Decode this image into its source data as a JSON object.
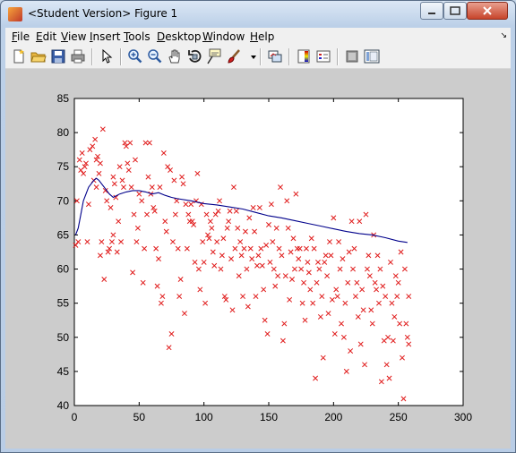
{
  "window": {
    "title": "<Student Version> Figure 1"
  },
  "menu": [
    "File",
    "Edit",
    "View",
    "Insert",
    "Tools",
    "Desktop",
    "Window",
    "Help"
  ],
  "toolbar_icons": [
    "new-figure-icon",
    "open-file-icon",
    "save-icon",
    "print-icon",
    "pointer-icon",
    "zoom-in-icon",
    "zoom-out-icon",
    "pan-hand-icon",
    "rotate-3d-icon",
    "data-cursor-icon",
    "brush-icon",
    "brush-dropdown-icon",
    "link-plot-icon",
    "colorbar-icon",
    "legend-icon",
    "hide-plot-tools-icon",
    "show-plot-tools-icon"
  ],
  "chart_data": {
    "type": "scatter",
    "title": "",
    "xlabel": "",
    "ylabel": "",
    "xlim": [
      0,
      300
    ],
    "ylim": [
      40,
      85
    ],
    "xticks": [
      0,
      50,
      100,
      150,
      200,
      250,
      300
    ],
    "yticks": [
      40,
      45,
      50,
      55,
      60,
      65,
      70,
      75,
      80,
      85
    ],
    "grid": false,
    "colors": {
      "scatter": "#e01a1a",
      "line": "#00008b"
    },
    "series": [
      {
        "kind": "scatter",
        "marker": "x",
        "points": [
          [
            1,
            63.5
          ],
          [
            2,
            70
          ],
          [
            3,
            64
          ],
          [
            4,
            76
          ],
          [
            5,
            74.5
          ],
          [
            6,
            77
          ],
          [
            7,
            74
          ],
          [
            8,
            75
          ],
          [
            9,
            75.5
          ],
          [
            10,
            64
          ],
          [
            11,
            69.5
          ],
          [
            12,
            77.5
          ],
          [
            14,
            78
          ],
          [
            15,
            73
          ],
          [
            16,
            79
          ],
          [
            17,
            72
          ],
          [
            17,
            76
          ],
          [
            18,
            76.5
          ],
          [
            19,
            74
          ],
          [
            20,
            62
          ],
          [
            20,
            75.5
          ],
          [
            21,
            64
          ],
          [
            22,
            80.5
          ],
          [
            23,
            58.5
          ],
          [
            24,
            71.5
          ],
          [
            25,
            70
          ],
          [
            26,
            62.5
          ],
          [
            27,
            63
          ],
          [
            28,
            69
          ],
          [
            29,
            64
          ],
          [
            30,
            73.5
          ],
          [
            30,
            65
          ],
          [
            31,
            72.5
          ],
          [
            32,
            70.5
          ],
          [
            33,
            62.5
          ],
          [
            34,
            67
          ],
          [
            35,
            75
          ],
          [
            36,
            64
          ],
          [
            37,
            73
          ],
          [
            38,
            72
          ],
          [
            39,
            78.5
          ],
          [
            40,
            78
          ],
          [
            41,
            75.5
          ],
          [
            42,
            74.5
          ],
          [
            43,
            78.5
          ],
          [
            44,
            72
          ],
          [
            45,
            59.5
          ],
          [
            46,
            68
          ],
          [
            47,
            76
          ],
          [
            48,
            64
          ],
          [
            49,
            66
          ],
          [
            50,
            71
          ],
          [
            52,
            70
          ],
          [
            53,
            58
          ],
          [
            54,
            63
          ],
          [
            55,
            78.5
          ],
          [
            56,
            68
          ],
          [
            57,
            73.5
          ],
          [
            58,
            78.5
          ],
          [
            59,
            71
          ],
          [
            60,
            72
          ],
          [
            61,
            69
          ],
          [
            62,
            68.5
          ],
          [
            63,
            63
          ],
          [
            64,
            57.5
          ],
          [
            65,
            61.5
          ],
          [
            66,
            72
          ],
          [
            67,
            55
          ],
          [
            68,
            56
          ],
          [
            69,
            77
          ],
          [
            70,
            67
          ],
          [
            71,
            65.5
          ],
          [
            72,
            75
          ],
          [
            73,
            48.5
          ],
          [
            74,
            74.5
          ],
          [
            75,
            50.5
          ],
          [
            76,
            64
          ],
          [
            77,
            73
          ],
          [
            78,
            68
          ],
          [
            79,
            70
          ],
          [
            80,
            63
          ],
          [
            81,
            56
          ],
          [
            82,
            58.5
          ],
          [
            83,
            73.5
          ],
          [
            84,
            72.5
          ],
          [
            85,
            53.5
          ],
          [
            86,
            69.5
          ],
          [
            87,
            63
          ],
          [
            88,
            68
          ],
          [
            89,
            67
          ],
          [
            90,
            69.5
          ],
          [
            91,
            67
          ],
          [
            92,
            66.5
          ],
          [
            93,
            61
          ],
          [
            94,
            70
          ],
          [
            95,
            74
          ],
          [
            96,
            60
          ],
          [
            97,
            57
          ],
          [
            98,
            69.5
          ],
          [
            99,
            64
          ],
          [
            100,
            61
          ],
          [
            101,
            55
          ],
          [
            102,
            68
          ],
          [
            103,
            65
          ],
          [
            104,
            64.5
          ],
          [
            105,
            67
          ],
          [
            106,
            66
          ],
          [
            107,
            62.5
          ],
          [
            108,
            60.5
          ],
          [
            109,
            68
          ],
          [
            110,
            64
          ],
          [
            111,
            68.5
          ],
          [
            112,
            70
          ],
          [
            113,
            60
          ],
          [
            114,
            62
          ],
          [
            115,
            64.5
          ],
          [
            116,
            56
          ],
          [
            117,
            55.5
          ],
          [
            118,
            66
          ],
          [
            119,
            67
          ],
          [
            120,
            68.5
          ],
          [
            121,
            61.5
          ],
          [
            122,
            54
          ],
          [
            123,
            72
          ],
          [
            124,
            63
          ],
          [
            125,
            68.5
          ],
          [
            126,
            66
          ],
          [
            127,
            59
          ],
          [
            128,
            64
          ],
          [
            129,
            62
          ],
          [
            130,
            56
          ],
          [
            131,
            63
          ],
          [
            132,
            65.5
          ],
          [
            133,
            60
          ],
          [
            134,
            54.5
          ],
          [
            135,
            67.5
          ],
          [
            136,
            63
          ],
          [
            137,
            61.5
          ],
          [
            138,
            69
          ],
          [
            139,
            65.5
          ],
          [
            140,
            56
          ],
          [
            141,
            60.5
          ],
          [
            142,
            62
          ],
          [
            143,
            69
          ],
          [
            144,
            63
          ],
          [
            145,
            60.5
          ],
          [
            146,
            57
          ],
          [
            147,
            52.5
          ],
          [
            148,
            63.5
          ],
          [
            149,
            50.5
          ],
          [
            150,
            66.5
          ],
          [
            151,
            61
          ],
          [
            152,
            69.5
          ],
          [
            153,
            64
          ],
          [
            154,
            60
          ],
          [
            155,
            57.5
          ],
          [
            156,
            66
          ],
          [
            157,
            59
          ],
          [
            158,
            63
          ],
          [
            159,
            72
          ],
          [
            160,
            62
          ],
          [
            161,
            49.5
          ],
          [
            162,
            52
          ],
          [
            163,
            59
          ],
          [
            164,
            70
          ],
          [
            165,
            66
          ],
          [
            166,
            55.5
          ],
          [
            167,
            62.5
          ],
          [
            168,
            58.5
          ],
          [
            169,
            64.5
          ],
          [
            170,
            60
          ],
          [
            171,
            71
          ],
          [
            172,
            63
          ],
          [
            173,
            61.5
          ],
          [
            174,
            63
          ],
          [
            175,
            60
          ],
          [
            176,
            55
          ],
          [
            177,
            58
          ],
          [
            178,
            52.5
          ],
          [
            179,
            63
          ],
          [
            180,
            61
          ],
          [
            181,
            59.5
          ],
          [
            182,
            57
          ],
          [
            183,
            64.5
          ],
          [
            184,
            55
          ],
          [
            185,
            63
          ],
          [
            186,
            44
          ],
          [
            187,
            58
          ],
          [
            188,
            61
          ],
          [
            189,
            60
          ],
          [
            190,
            53
          ],
          [
            191,
            56
          ],
          [
            192,
            47
          ],
          [
            193,
            61
          ],
          [
            194,
            62
          ],
          [
            195,
            59
          ],
          [
            196,
            53.5
          ],
          [
            197,
            64
          ],
          [
            198,
            62
          ],
          [
            199,
            55.5
          ],
          [
            200,
            67.5
          ],
          [
            201,
            50.5
          ],
          [
            202,
            57
          ],
          [
            203,
            56
          ],
          [
            204,
            64
          ],
          [
            205,
            60
          ],
          [
            206,
            52
          ],
          [
            207,
            61.5
          ],
          [
            208,
            50
          ],
          [
            209,
            55
          ],
          [
            210,
            45
          ],
          [
            211,
            58
          ],
          [
            212,
            62.5
          ],
          [
            213,
            48
          ],
          [
            214,
            67
          ],
          [
            215,
            60
          ],
          [
            216,
            63
          ],
          [
            217,
            56
          ],
          [
            218,
            58
          ],
          [
            219,
            53
          ],
          [
            220,
            67
          ],
          [
            221,
            49
          ],
          [
            222,
            57
          ],
          [
            223,
            54
          ],
          [
            224,
            46
          ],
          [
            225,
            68
          ],
          [
            226,
            60
          ],
          [
            227,
            62
          ],
          [
            228,
            59
          ],
          [
            229,
            54
          ],
          [
            230,
            52
          ],
          [
            231,
            65
          ],
          [
            232,
            58
          ],
          [
            233,
            57
          ],
          [
            234,
            62
          ],
          [
            235,
            55
          ],
          [
            236,
            60
          ],
          [
            237,
            43.5
          ],
          [
            238,
            57.5
          ],
          [
            239,
            49.5
          ],
          [
            240,
            56
          ],
          [
            241,
            46
          ],
          [
            242,
            50
          ],
          [
            243,
            44
          ],
          [
            244,
            61
          ],
          [
            245,
            55
          ],
          [
            246,
            49.5
          ],
          [
            247,
            53
          ],
          [
            248,
            59
          ],
          [
            249,
            56
          ],
          [
            250,
            58
          ],
          [
            251,
            52
          ],
          [
            252,
            62.5
          ],
          [
            253,
            47
          ],
          [
            254,
            41
          ],
          [
            255,
            60
          ],
          [
            256,
            52
          ],
          [
            257,
            50
          ],
          [
            258,
            56
          ],
          [
            258,
            49
          ]
        ]
      },
      {
        "kind": "line",
        "points": [
          [
            1,
            65
          ],
          [
            3,
            66
          ],
          [
            5,
            68
          ],
          [
            7,
            70
          ],
          [
            9,
            71
          ],
          [
            11,
            72
          ],
          [
            13,
            72.5
          ],
          [
            15,
            73
          ],
          [
            17,
            73.3
          ],
          [
            19,
            73
          ],
          [
            21,
            72.5
          ],
          [
            23,
            72
          ],
          [
            25,
            71.5
          ],
          [
            27,
            71
          ],
          [
            30,
            70.5
          ],
          [
            35,
            71
          ],
          [
            40,
            71.3
          ],
          [
            45,
            71.5
          ],
          [
            50,
            71.5
          ],
          [
            55,
            71.3
          ],
          [
            60,
            71
          ],
          [
            65,
            71.2
          ],
          [
            70,
            70.8
          ],
          [
            75,
            70.5
          ],
          [
            80,
            70.3
          ],
          [
            90,
            70
          ],
          [
            100,
            69.6
          ],
          [
            110,
            69.4
          ],
          [
            120,
            69.1
          ],
          [
            130,
            68.8
          ],
          [
            140,
            68.3
          ],
          [
            150,
            67.8
          ],
          [
            160,
            67.5
          ],
          [
            170,
            67.1
          ],
          [
            180,
            66.7
          ],
          [
            190,
            66.3
          ],
          [
            200,
            65.9
          ],
          [
            210,
            65.5
          ],
          [
            220,
            65.2
          ],
          [
            230,
            65
          ],
          [
            240,
            64.6
          ],
          [
            250,
            64.1
          ],
          [
            257,
            63.9
          ]
        ]
      }
    ]
  }
}
